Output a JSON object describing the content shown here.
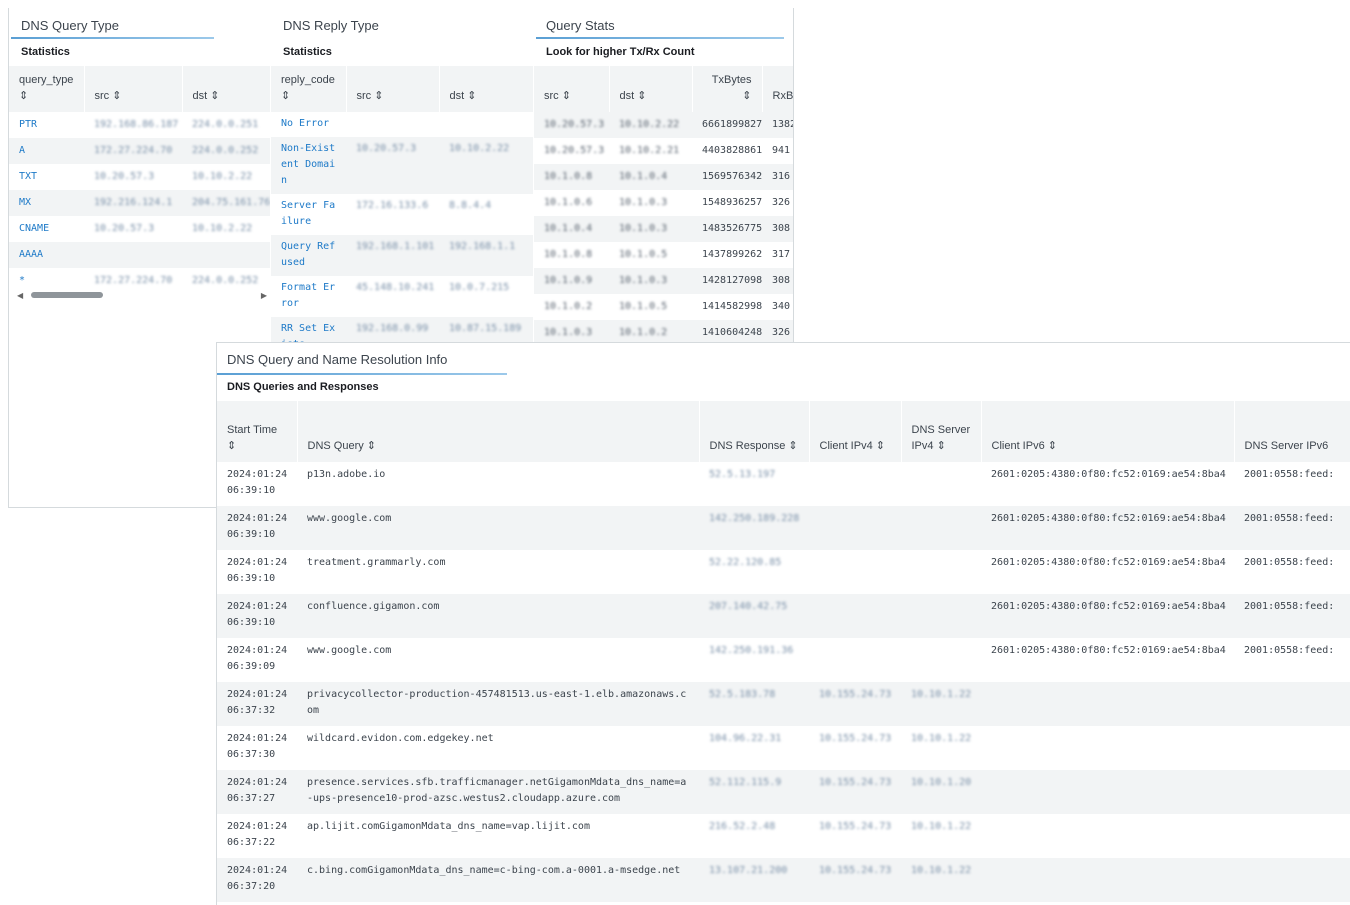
{
  "query_type_panel": {
    "title": "DNS Query Type",
    "subtitle": "Statistics",
    "columns": [
      "query_type",
      "src",
      "dst"
    ],
    "sort_glyph": "⇕",
    "rows": [
      {
        "query_type": "PTR",
        "src": "192.168.86.187",
        "dst": "224.0.0.251"
      },
      {
        "query_type": "A",
        "src": "172.27.224.70",
        "dst": "224.0.0.252"
      },
      {
        "query_type": "TXT",
        "src": "10.20.57.3",
        "dst": "10.10.2.22"
      },
      {
        "query_type": "MX",
        "src": "192.216.124.1",
        "dst": "204.75.161.76"
      },
      {
        "query_type": "CNAME",
        "src": "10.20.57.3",
        "dst": "10.10.2.22"
      },
      {
        "query_type": "AAAA",
        "src": "",
        "dst": ""
      },
      {
        "query_type": "*",
        "src": "172.27.224.70",
        "dst": "224.0.0.252"
      }
    ],
    "scroll_left": "◀",
    "scroll_right": "▶"
  },
  "reply_type_panel": {
    "title": "DNS Reply Type",
    "subtitle": "Statistics",
    "columns": [
      "reply_code",
      "src",
      "dst"
    ],
    "rows": [
      {
        "reply_code": "No Error",
        "src": "",
        "dst": ""
      },
      {
        "reply_code": "Non-Existent Domain",
        "src": "10.20.57.3",
        "dst": "10.10.2.22"
      },
      {
        "reply_code": "Server Failure",
        "src": "172.16.133.6",
        "dst": "8.8.4.4"
      },
      {
        "reply_code": "Query Refused",
        "src": "192.168.1.101",
        "dst": "192.168.1.1"
      },
      {
        "reply_code": "Format Error",
        "src": "45.148.10.241",
        "dst": "10.0.7.215"
      },
      {
        "reply_code": "RR Set Exists",
        "src": "192.168.0.99",
        "dst": "10.87.15.189"
      }
    ]
  },
  "query_stats_panel": {
    "title": "Query Stats",
    "subtitle": "Look for higher Tx/Rx Count",
    "columns": [
      "src",
      "dst",
      "TxBytes",
      "RxBytes"
    ],
    "rows": [
      {
        "src": "10.20.57.3",
        "dst": "10.10.2.22",
        "tx": "6661899827",
        "rx": "1382"
      },
      {
        "src": "10.20.57.3",
        "dst": "10.10.2.21",
        "tx": "4403828861",
        "rx": "941"
      },
      {
        "src": "10.1.0.8",
        "dst": "10.1.0.4",
        "tx": "1569576342",
        "rx": "316"
      },
      {
        "src": "10.1.0.6",
        "dst": "10.1.0.3",
        "tx": "1548936257",
        "rx": "326"
      },
      {
        "src": "10.1.0.4",
        "dst": "10.1.0.3",
        "tx": "1483526775",
        "rx": "308"
      },
      {
        "src": "10.1.0.8",
        "dst": "10.1.0.5",
        "tx": "1437899262",
        "rx": "317"
      },
      {
        "src": "10.1.0.9",
        "dst": "10.1.0.3",
        "tx": "1428127098",
        "rx": "308"
      },
      {
        "src": "10.1.0.2",
        "dst": "10.1.0.5",
        "tx": "1414582998",
        "rx": "340"
      },
      {
        "src": "10.1.0.3",
        "dst": "10.1.0.2",
        "tx": "1410604248",
        "rx": "326"
      }
    ]
  },
  "resolution_panel": {
    "title": "DNS Query and Name Resolution Info",
    "subtitle": "DNS Queries and Responses",
    "columns": {
      "start_time": "Start Time",
      "dns_query": "DNS Query",
      "dns_response": "DNS Response",
      "client_ipv4": "Client IPv4",
      "dns_server_ipv4": "DNS Server IPv4",
      "client_ipv6": "Client IPv6",
      "dns_server_ipv6": "DNS Server IPv6"
    },
    "rows": [
      {
        "time": "2024:01:24 06:39:10",
        "query": "p13n.adobe.io",
        "response": "52.5.13.197",
        "cip4": "",
        "sip4": "",
        "cip6": "2601:0205:4380:0f80:fc52:0169:ae54:8ba4",
        "sip6": "2001:0558:feed:"
      },
      {
        "time": "2024:01:24 06:39:10",
        "query": "www.google.com",
        "response": "142.250.189.228",
        "cip4": "",
        "sip4": "",
        "cip6": "2601:0205:4380:0f80:fc52:0169:ae54:8ba4",
        "sip6": "2001:0558:feed:"
      },
      {
        "time": "2024:01:24 06:39:10",
        "query": "treatment.grammarly.com",
        "response": "52.22.120.85",
        "cip4": "",
        "sip4": "",
        "cip6": "2601:0205:4380:0f80:fc52:0169:ae54:8ba4",
        "sip6": "2001:0558:feed:"
      },
      {
        "time": "2024:01:24 06:39:10",
        "query": "confluence.gigamon.com",
        "response": "207.140.42.75",
        "cip4": "",
        "sip4": "",
        "cip6": "2601:0205:4380:0f80:fc52:0169:ae54:8ba4",
        "sip6": "2001:0558:feed:"
      },
      {
        "time": "2024:01:24 06:39:09",
        "query": "www.google.com",
        "response": "142.250.191.36",
        "cip4": "",
        "sip4": "",
        "cip6": "2601:0205:4380:0f80:fc52:0169:ae54:8ba4",
        "sip6": "2001:0558:feed:"
      },
      {
        "time": "2024:01:24 06:37:32",
        "query": "privacycollector-production-457481513.us-east-1.elb.amazonaws.com",
        "response": "52.5.183.78",
        "cip4": "10.155.24.73",
        "sip4": "10.10.1.22",
        "cip6": "",
        "sip6": ""
      },
      {
        "time": "2024:01:24 06:37:30",
        "query": "wildcard.evidon.com.edgekey.net",
        "response": "104.96.22.31",
        "cip4": "10.155.24.73",
        "sip4": "10.10.1.22",
        "cip6": "",
        "sip6": ""
      },
      {
        "time": "2024:01:24 06:37:27",
        "query": "presence.services.sfb.trafficmanager.netGigamonMdata_dns_name=a-ups-presence10-prod-azsc.westus2.cloudapp.azure.com",
        "response": "52.112.115.9",
        "cip4": "10.155.24.73",
        "sip4": "10.10.1.20",
        "cip6": "",
        "sip6": ""
      },
      {
        "time": "2024:01:24 06:37:22",
        "query": "ap.lijit.comGigamonMdata_dns_name=vap.lijit.com",
        "response": "216.52.2.48",
        "cip4": "10.155.24.73",
        "sip4": "10.10.1.22",
        "cip6": "",
        "sip6": ""
      },
      {
        "time": "2024:01:24 06:37:20",
        "query": "c.bing.comGigamonMdata_dns_name=c-bing-com.a-0001.a-msedge.net",
        "response": "13.107.21.200",
        "cip4": "10.155.24.73",
        "sip4": "10.10.1.22",
        "cip6": "",
        "sip6": ""
      }
    ]
  }
}
